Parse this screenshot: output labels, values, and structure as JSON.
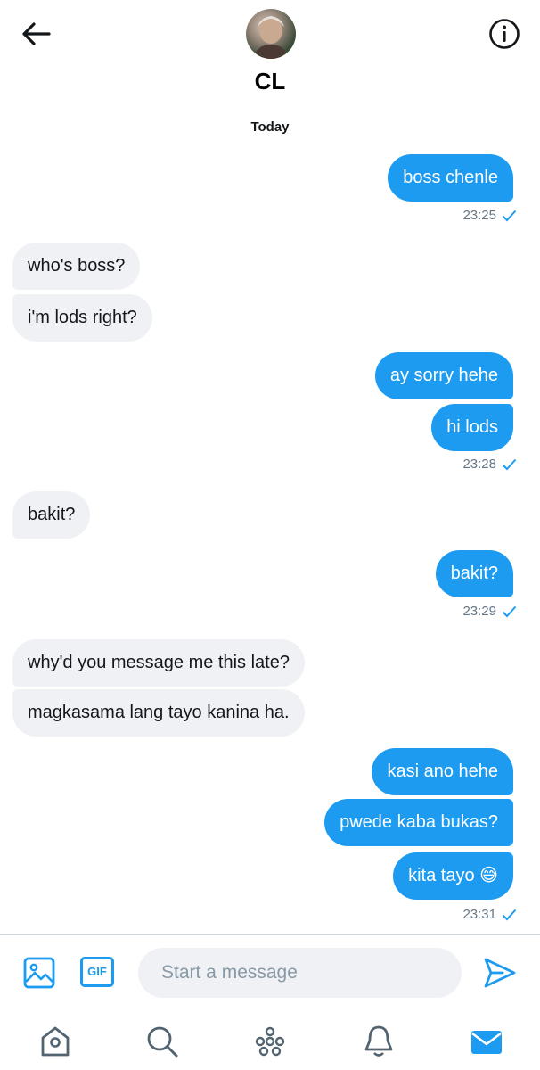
{
  "header": {
    "contact_name": "CL",
    "date_separator": "Today"
  },
  "messages": [
    {
      "dir": "out",
      "text": "boss chenle"
    },
    {
      "time": "23:25",
      "read": true
    },
    {
      "dir": "in",
      "text": "who's boss?"
    },
    {
      "dir": "in",
      "text": "i'm lods right?"
    },
    {
      "dir": "out",
      "text": "ay sorry hehe"
    },
    {
      "dir": "out",
      "text": "hi lods"
    },
    {
      "time": "23:28",
      "read": true
    },
    {
      "dir": "in",
      "text": "bakit?"
    },
    {
      "dir": "out",
      "text": "bakit?"
    },
    {
      "time": "23:29",
      "read": true
    },
    {
      "dir": "in",
      "text": "why'd you message me this late?"
    },
    {
      "dir": "in",
      "text": "magkasama lang tayo kanina ha."
    },
    {
      "dir": "out",
      "text": "kasi ano hehe"
    },
    {
      "dir": "out",
      "text": "pwede kaba bukas?"
    },
    {
      "dir": "out",
      "text": "kita tayo 😅"
    },
    {
      "time": "23:31",
      "read": true
    }
  ],
  "composer": {
    "gif_label": "GIF",
    "placeholder": "Start a message"
  },
  "icons": {
    "back": "arrow-left-icon",
    "info": "info-icon",
    "image": "image-icon",
    "send": "send-icon",
    "home": "home-icon",
    "search": "search-icon",
    "spaces": "spaces-icon",
    "notifications": "bell-icon",
    "messages": "mail-icon"
  },
  "colors": {
    "accent": "#1d9bf0",
    "incoming_bubble": "#eff1f4",
    "meta_text": "#657786"
  }
}
